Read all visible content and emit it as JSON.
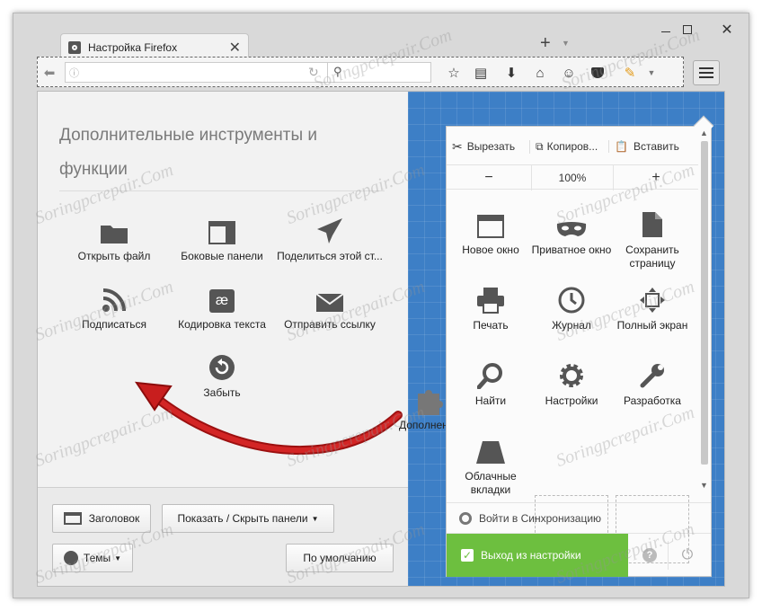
{
  "window": {
    "tab_title": "Настройка Firefox",
    "controls": [
      "minimize",
      "maximize",
      "close"
    ]
  },
  "toolbar": {
    "url_placeholder": "",
    "search_placeholder": ""
  },
  "customize": {
    "heading": "Дополнительные инструменты и функции",
    "tools": [
      {
        "label": "Открыть файл",
        "icon": "folder-icon"
      },
      {
        "label": "Боковые панели",
        "icon": "sidebar-icon"
      },
      {
        "label": "Поделиться этой ст...",
        "icon": "share-icon"
      },
      {
        "label": "Подписаться",
        "icon": "rss-icon"
      },
      {
        "label": "Кодировка текста",
        "icon": "encoding-icon"
      },
      {
        "label": "Отправить ссылку",
        "icon": "email-icon"
      },
      {
        "label": "Забыть",
        "icon": "forget-icon"
      }
    ],
    "bottom": {
      "title_bar_label": "Заголовок",
      "toolbars_label": "Показать / Скрыть панели",
      "themes_label": "Темы",
      "restore_label": "По умолчанию"
    }
  },
  "addon": {
    "label": "Дополнения"
  },
  "menu_panel": {
    "cut": "Вырезать",
    "copy": "Копиров...",
    "paste": "Вставить",
    "zoom_out": "−",
    "zoom_level": "100%",
    "zoom_in": "+",
    "items": [
      {
        "label": "Новое окно",
        "icon": "new-window-icon"
      },
      {
        "label": "Приватное окно",
        "icon": "private-mask-icon"
      },
      {
        "label": "Сохранить страницу",
        "icon": "save-page-icon"
      },
      {
        "label": "Печать",
        "icon": "print-icon"
      },
      {
        "label": "Журнал",
        "icon": "history-clock-icon"
      },
      {
        "label": "Полный экран",
        "icon": "fullscreen-icon"
      },
      {
        "label": "Найти",
        "icon": "find-icon"
      },
      {
        "label": "Настройки",
        "icon": "settings-gear-icon"
      },
      {
        "label": "Разработка",
        "icon": "developer-wrench-icon"
      },
      {
        "label": "Облачные вкладки",
        "icon": "cloud-tabs-icon"
      }
    ],
    "sync_label": "Войти в Синхронизацию",
    "exit_label": "Выход из настройки"
  },
  "watermark": "Soringpcrepair.Com"
}
